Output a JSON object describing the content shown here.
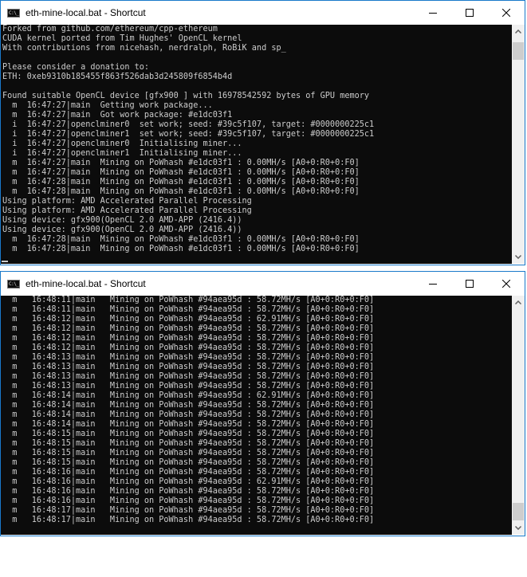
{
  "windows": [
    {
      "title": "eth-mine-local.bat - Shortcut",
      "icon": "cmd-console-icon",
      "icon_text": "C:\\_",
      "controls": {
        "minimize": "minimize-icon",
        "maximize": "maximize-icon",
        "close": "close-icon"
      },
      "scroll_position": 0.1,
      "lines": [
        "Forked from github.com/ethereum/cpp-ethereum",
        "CUDA kernel ported from Tim Hughes' OpenCL kernel",
        "With contributions from nicehash, nerdralph, RoBiK and sp_",
        "",
        "Please consider a donation to:",
        "ETH: 0xeb9310b185455f863f526dab3d245809f6854b4d",
        "",
        "Found suitable OpenCL device [gfx900 ] with 16978542592 bytes of GPU memory",
        "  m  16:47:27|main  Getting work package...",
        "  m  16:47:27|main  Got work package: #e1dc03f1",
        "  i  16:47:27|openclminer0  set work; seed: #39c5f107, target: #0000000225c1",
        "  i  16:47:27|openclminer1  set work; seed: #39c5f107, target: #0000000225c1",
        "  i  16:47:27|openclminer0  Initialising miner...",
        "  i  16:47:27|openclminer1  Initialising miner...",
        "  m  16:47:27|main  Mining on PoWhash #e1dc03f1 : 0.00MH/s [A0+0:R0+0:F0]",
        "  m  16:47:27|main  Mining on PoWhash #e1dc03f1 : 0.00MH/s [A0+0:R0+0:F0]",
        "  m  16:47:28|main  Mining on PoWhash #e1dc03f1 : 0.00MH/s [A0+0:R0+0:F0]",
        "  m  16:47:28|main  Mining on PoWhash #e1dc03f1 : 0.00MH/s [A0+0:R0+0:F0]",
        "Using platform: AMD Accelerated Parallel Processing",
        "Using platform: AMD Accelerated Parallel Processing",
        "Using device: gfx900(OpenCL 2.0 AMD-APP (2416.4))",
        "Using device: gfx900(OpenCL 2.0 AMD-APP (2416.4))",
        "  m  16:47:28|main  Mining on PoWhash #e1dc03f1 : 0.00MH/s [A0+0:R0+0:F0]",
        "  m  16:47:28|main  Mining on PoWhash #e1dc03f1 : 0.00MH/s [A0+0:R0+0:F0]"
      ]
    },
    {
      "title": "eth-mine-local.bat - Shortcut",
      "icon": "cmd-console-icon",
      "icon_text": "C:\\_",
      "controls": {
        "minimize": "minimize-icon",
        "maximize": "maximize-icon",
        "close": "close-icon"
      },
      "scroll_position": 0.95,
      "lines": [
        "  m   16:48:11|main   Mining on PoWhash #94aea95d : 58.72MH/s [A0+0:R0+0:F0]",
        "  m   16:48:11|main   Mining on PoWhash #94aea95d : 58.72MH/s [A0+0:R0+0:F0]",
        "  m   16:48:12|main   Mining on PoWhash #94aea95d : 62.91MH/s [A0+0:R0+0:F0]",
        "  m   16:48:12|main   Mining on PoWhash #94aea95d : 58.72MH/s [A0+0:R0+0:F0]",
        "  m   16:48:12|main   Mining on PoWhash #94aea95d : 58.72MH/s [A0+0:R0+0:F0]",
        "  m   16:48:12|main   Mining on PoWhash #94aea95d : 58.72MH/s [A0+0:R0+0:F0]",
        "  m   16:48:13|main   Mining on PoWhash #94aea95d : 58.72MH/s [A0+0:R0+0:F0]",
        "  m   16:48:13|main   Mining on PoWhash #94aea95d : 58.72MH/s [A0+0:R0+0:F0]",
        "  m   16:48:13|main   Mining on PoWhash #94aea95d : 58.72MH/s [A0+0:R0+0:F0]",
        "  m   16:48:13|main   Mining on PoWhash #94aea95d : 58.72MH/s [A0+0:R0+0:F0]",
        "  m   16:48:14|main   Mining on PoWhash #94aea95d : 62.91MH/s [A0+0:R0+0:F0]",
        "  m   16:48:14|main   Mining on PoWhash #94aea95d : 58.72MH/s [A0+0:R0+0:F0]",
        "  m   16:48:14|main   Mining on PoWhash #94aea95d : 58.72MH/s [A0+0:R0+0:F0]",
        "  m   16:48:14|main   Mining on PoWhash #94aea95d : 58.72MH/s [A0+0:R0+0:F0]",
        "  m   16:48:15|main   Mining on PoWhash #94aea95d : 58.72MH/s [A0+0:R0+0:F0]",
        "  m   16:48:15|main   Mining on PoWhash #94aea95d : 58.72MH/s [A0+0:R0+0:F0]",
        "  m   16:48:15|main   Mining on PoWhash #94aea95d : 58.72MH/s [A0+0:R0+0:F0]",
        "  m   16:48:15|main   Mining on PoWhash #94aea95d : 58.72MH/s [A0+0:R0+0:F0]",
        "  m   16:48:16|main   Mining on PoWhash #94aea95d : 58.72MH/s [A0+0:R0+0:F0]",
        "  m   16:48:16|main   Mining on PoWhash #94aea95d : 62.91MH/s [A0+0:R0+0:F0]",
        "  m   16:48:16|main   Mining on PoWhash #94aea95d : 58.72MH/s [A0+0:R0+0:F0]",
        "  m   16:48:16|main   Mining on PoWhash #94aea95d : 58.72MH/s [A0+0:R0+0:F0]",
        "  m   16:48:17|main   Mining on PoWhash #94aea95d : 58.72MH/s [A0+0:R0+0:F0]",
        "  m   16:48:17|main   Mining on PoWhash #94aea95d : 58.72MH/s [A0+0:R0+0:F0]"
      ]
    }
  ],
  "colors": {
    "console_bg": "#0c0c0c",
    "console_text": "#cccccc",
    "window_border": "#1979ca",
    "scrollbar_track": "#f0f0f0",
    "scrollbar_thumb": "#cdcdcd"
  }
}
